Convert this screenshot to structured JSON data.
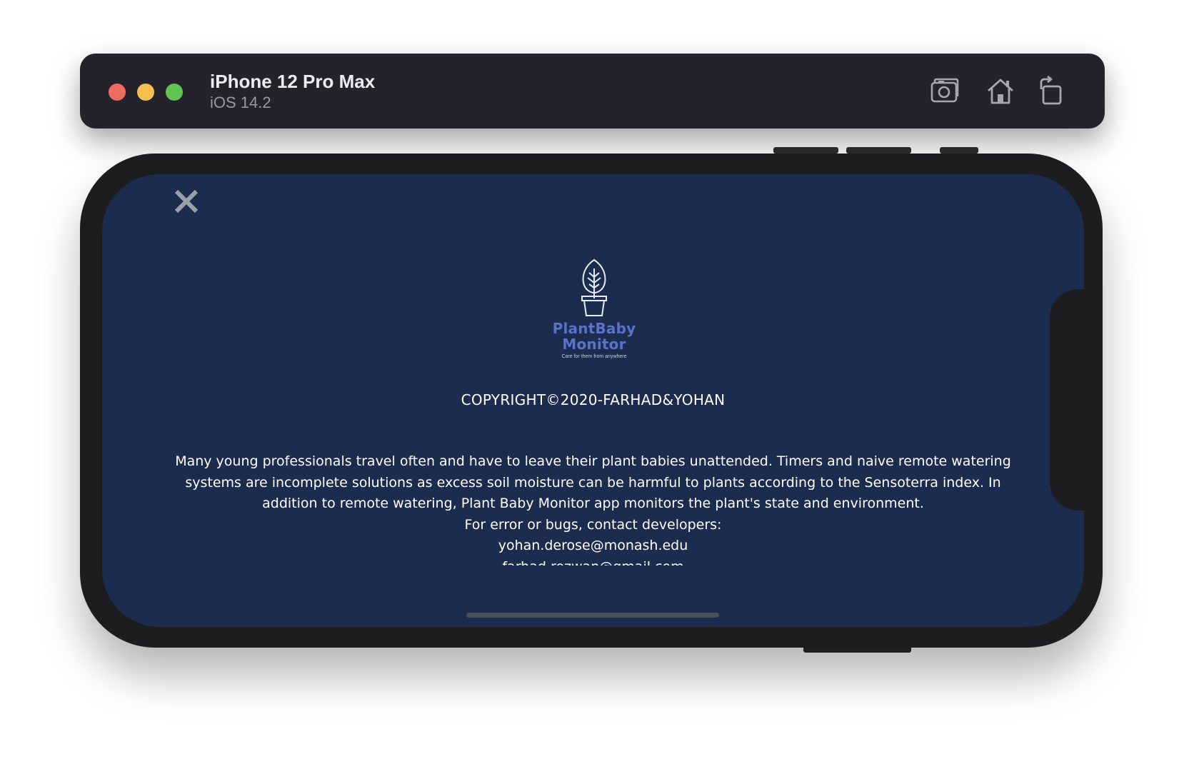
{
  "window": {
    "device_name": "iPhone 12 Pro Max",
    "os_version": "iOS 14.2",
    "toolbar_icons": [
      "screenshot-icon",
      "home-icon",
      "rotate-icon"
    ],
    "traffic_lights": {
      "close": "#ed6a5e",
      "minimize": "#f5bf4f",
      "zoom": "#61c554"
    }
  },
  "app": {
    "close_icon": "close-icon",
    "logo": {
      "line1": "PlantBaby",
      "line2": "Monitor",
      "tagline": "Care for them from anywhere"
    },
    "copyright": "COPYRIGHT©2020-FARHAD&YOHAN",
    "about": {
      "description": "Many young professionals travel often and have to leave their plant babies unattended. Timers and naive remote watering systems are incomplete solutions as excess soil moisture can be harmful to plants according to the Sensoterra index. In addition to remote watering, Plant Baby Monitor app monitors the plant's state and environment.",
      "contact_heading": "For error or bugs, contact developers:",
      "emails": [
        "yohan.derose@monash.edu",
        "farhad.rezwan@gmail.com"
      ]
    },
    "colors": {
      "background": "#1c2c4f",
      "logo_text": "#5a73c7",
      "text": "#ffffff"
    }
  }
}
